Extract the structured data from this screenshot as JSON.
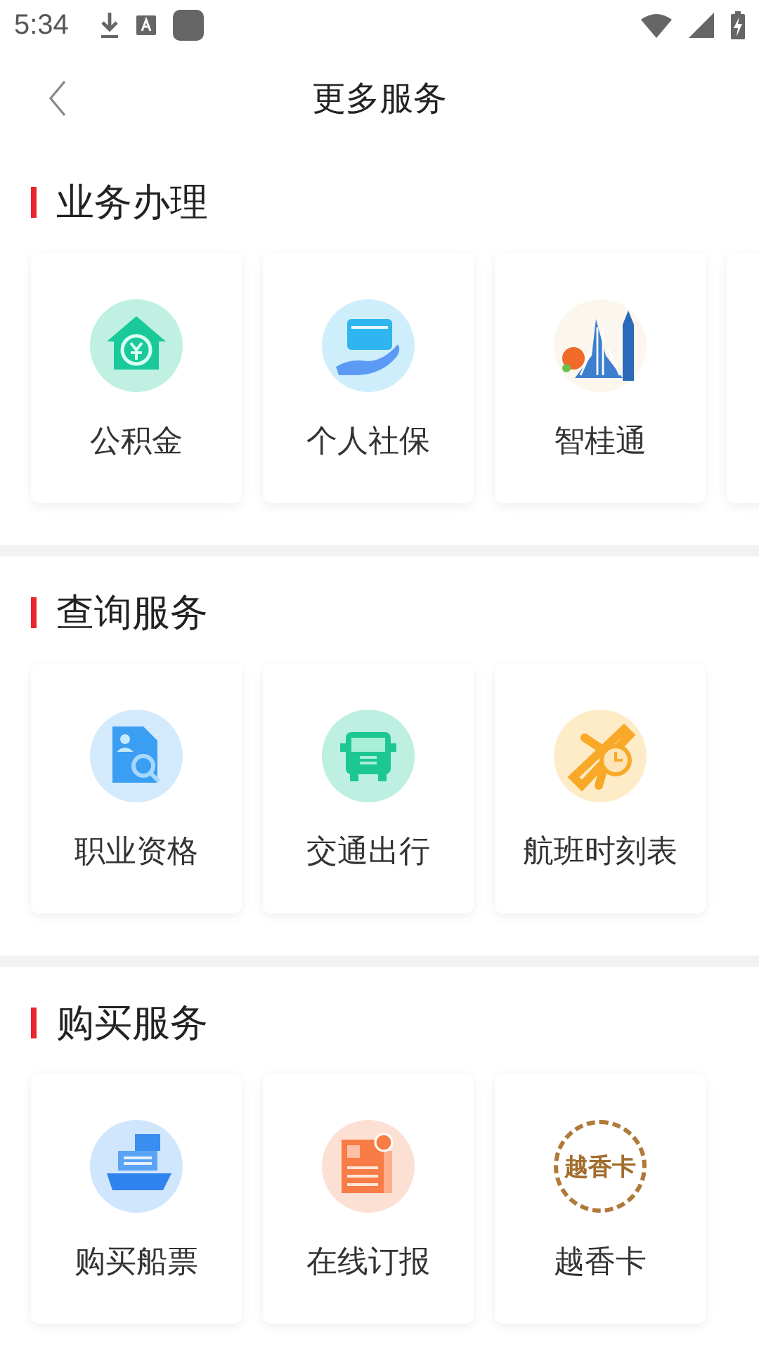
{
  "status_bar": {
    "time": "5:34"
  },
  "header": {
    "title": "更多服务"
  },
  "sections": [
    {
      "title": "业务办理",
      "cut_off_card": true,
      "items": [
        {
          "label": "公积金",
          "kind": "house"
        },
        {
          "label": "个人社保",
          "kind": "card"
        },
        {
          "label": "智桂通",
          "kind": "landmark"
        }
      ]
    },
    {
      "title": "查询服务",
      "items": [
        {
          "label": "职业资格",
          "kind": "document"
        },
        {
          "label": "交通出行",
          "kind": "bus"
        },
        {
          "label": "航班时刻表",
          "kind": "plane"
        }
      ]
    },
    {
      "title": "购买服务",
      "items": [
        {
          "label": "购买船票",
          "kind": "ship"
        },
        {
          "label": "在线订报",
          "kind": "newspaper"
        },
        {
          "label": "越香卡",
          "kind": "seal",
          "logo_text": "越香卡"
        }
      ]
    }
  ]
}
